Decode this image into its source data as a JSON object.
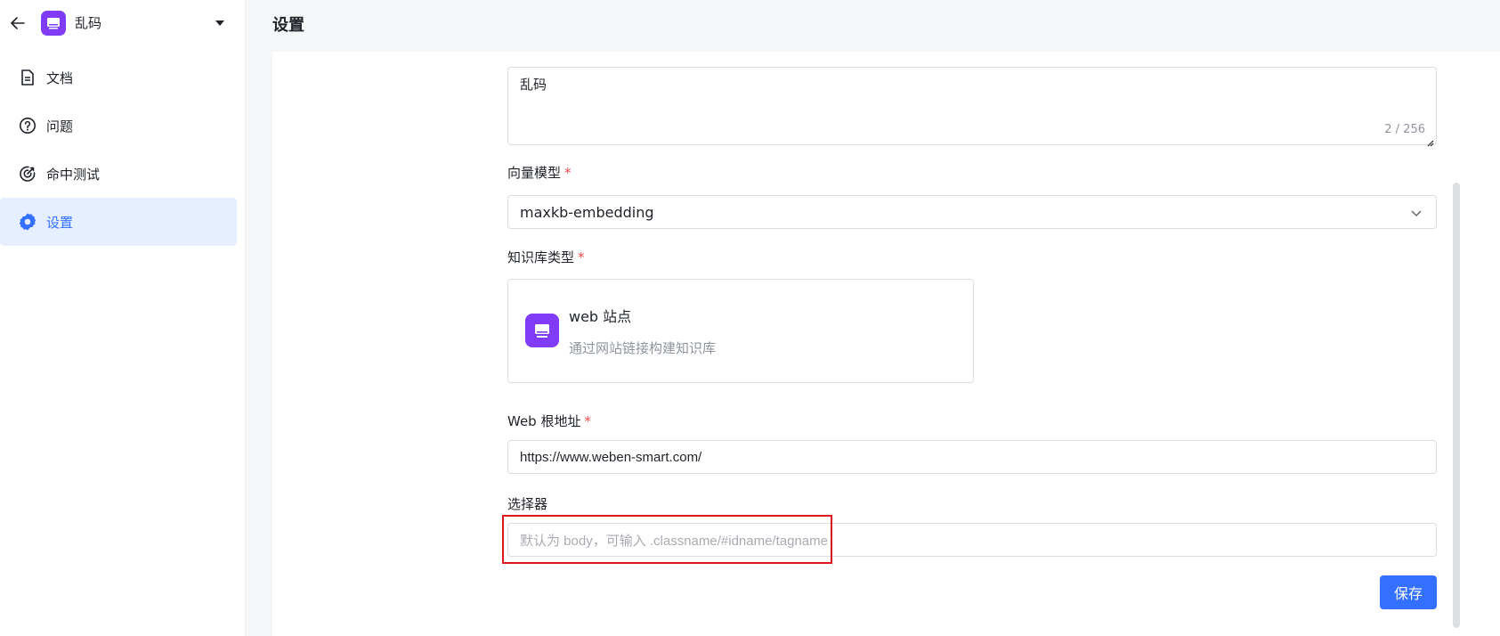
{
  "app": {
    "name": "乱码"
  },
  "nav": [
    {
      "label": "文档",
      "icon": "document-icon"
    },
    {
      "label": "问题",
      "icon": "question-circle-icon"
    },
    {
      "label": "命中测试",
      "icon": "target-icon"
    },
    {
      "label": "设置",
      "icon": "gear-icon",
      "active": true
    }
  ],
  "page": {
    "title": "设置"
  },
  "form": {
    "description": {
      "value": "乱码",
      "count": "2 / 256"
    },
    "embedding_model": {
      "label": "向量模型",
      "required": "*",
      "value": "maxkb-embedding"
    },
    "kb_type": {
      "label": "知识库类型",
      "required": "*",
      "card_title": "web 站点",
      "card_desc": "通过网站链接构建知识库"
    },
    "web_root": {
      "label": "Web 根地址",
      "required": "*",
      "value": "https://www.weben-smart.com/"
    },
    "selector": {
      "label": "选择器",
      "placeholder": "默认为 body，可输入 .classname/#idname/tagname"
    },
    "save_label": "保存"
  },
  "colors": {
    "accent": "#3370ff",
    "brand_purple": "#7f3bf5",
    "highlight": "#e0141c",
    "required": "#f54a45"
  }
}
